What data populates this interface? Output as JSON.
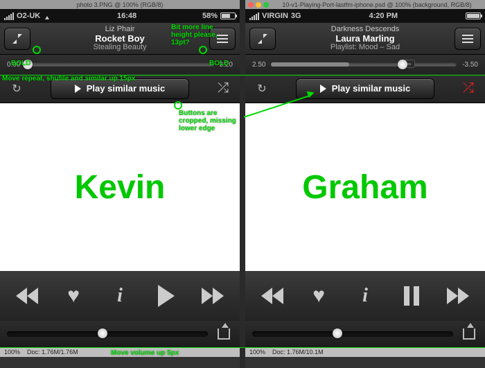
{
  "left": {
    "os_tab": "photo 3.PNG @ 100% (RGB/8)",
    "status": {
      "carrier": "O2-UK",
      "time": "16:48",
      "battery_pct": "58%"
    },
    "now_playing": {
      "artist": "Liz Phair",
      "track": "Rocket Boy",
      "album": "Stealing Beauty"
    },
    "scrub": {
      "elapsed": "0:00",
      "remaining": "3:20"
    },
    "play_similar": "Play similar music",
    "big_name": "Kevin",
    "doc": {
      "zoom": "100%",
      "info": "Doc: 1.76M/1.76M"
    }
  },
  "right": {
    "os_tab": "10-v1-Playing-Port-lastfm-iphone.psd @ 100% (background, RGB/8)",
    "status": {
      "carrier": "VIRGIN",
      "net": "3G",
      "time": "4:20 PM"
    },
    "now_playing": {
      "artist": "Darkness Descends",
      "track": "Laura Marling",
      "album": "Playlist: Mood – Sad"
    },
    "scrub": {
      "elapsed": "2.50",
      "remaining": "-3.50"
    },
    "play_similar": "Play similar music",
    "big_name": "Graham",
    "doc": {
      "zoom": "100%",
      "info": "Doc: 1.76M/10.1M"
    }
  },
  "annotations": {
    "bold_l": "BOLD",
    "bold_r": "BOLD",
    "line_height": "Bit more line height please, 13pt?",
    "move_row": "Move repeat, shufile and similar up 15px",
    "cropped": "Buttons are cropped, missing lower edge",
    "move_vol": "Move volume up 5px"
  }
}
